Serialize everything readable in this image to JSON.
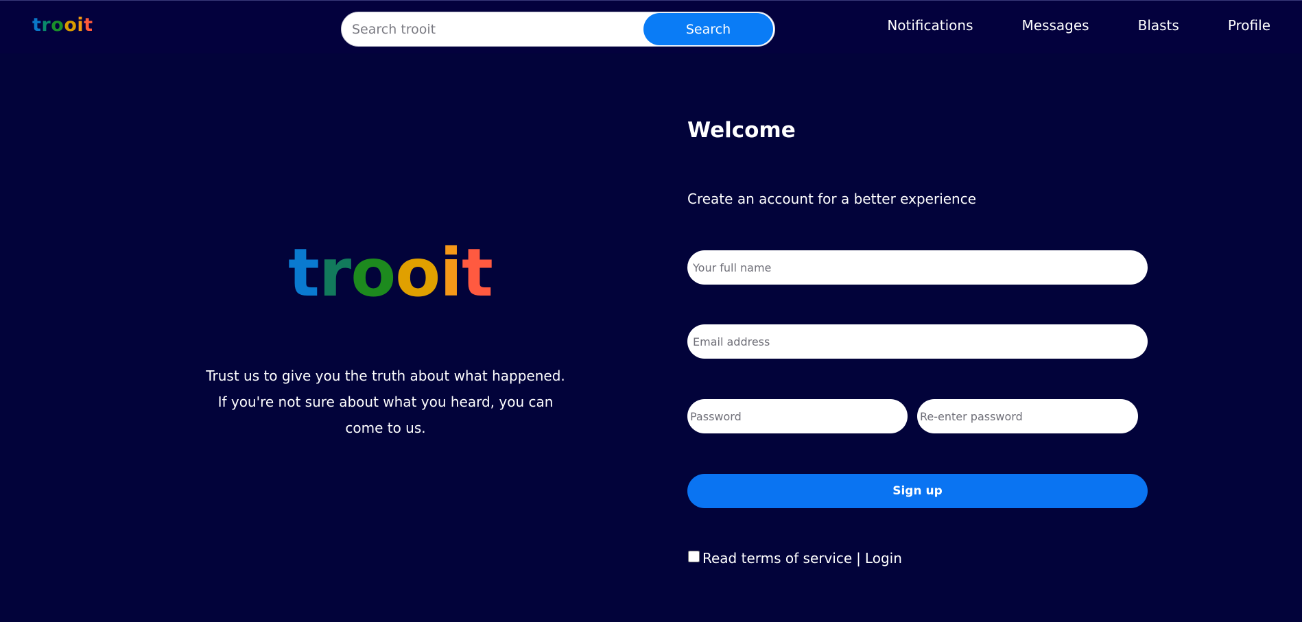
{
  "header": {
    "brand_letters": [
      {
        "char": "t",
        "color": "#0a77c8"
      },
      {
        "char": "r",
        "color": "#0a8a6a"
      },
      {
        "char": "o",
        "color": "#1a8f2a"
      },
      {
        "char": "o",
        "color": "#d89a00"
      },
      {
        "char": "i",
        "color": "#f19a10"
      },
      {
        "char": "t",
        "color": "#ff5a3a"
      }
    ],
    "search": {
      "placeholder": "Search trooit",
      "value": "",
      "button_label": "Search"
    },
    "nav": [
      {
        "label": "Notifications",
        "name": "nav-notifications"
      },
      {
        "label": "Messages",
        "name": "nav-messages"
      },
      {
        "label": "Blasts",
        "name": "nav-blasts"
      },
      {
        "label": "Profile",
        "name": "nav-profile"
      }
    ]
  },
  "hero": {
    "logo_letters": [
      {
        "char": "t",
        "color": "#0a7ad0"
      },
      {
        "char": "r",
        "color": "#127a5c"
      },
      {
        "char": "o",
        "color": "#1d8a1e"
      },
      {
        "char": "o",
        "color": "#e0a000"
      },
      {
        "char": "i",
        "color": "#f59818"
      },
      {
        "char": "t",
        "color": "#ff5a40"
      }
    ],
    "tagline_line1": "Trust us to give you the truth about what happened.",
    "tagline_line2": "If you're not sure about what you heard, you can",
    "tagline_line3": "come to us."
  },
  "form": {
    "title": "Welcome",
    "subtitle": "Create an account for a better experience",
    "full_name": {
      "placeholder": "Your full name",
      "value": ""
    },
    "email": {
      "placeholder": "Email address",
      "value": ""
    },
    "password": {
      "placeholder": "Password",
      "value": ""
    },
    "reenter_password": {
      "placeholder": "Re-enter password",
      "value": ""
    },
    "signup_label": "Sign up",
    "terms": {
      "checked": false,
      "terms_label": "Read terms of service",
      "separator": "|",
      "login_label": "Login"
    }
  },
  "colors": {
    "background": "#02033a",
    "accent": "#0a7cf6"
  }
}
